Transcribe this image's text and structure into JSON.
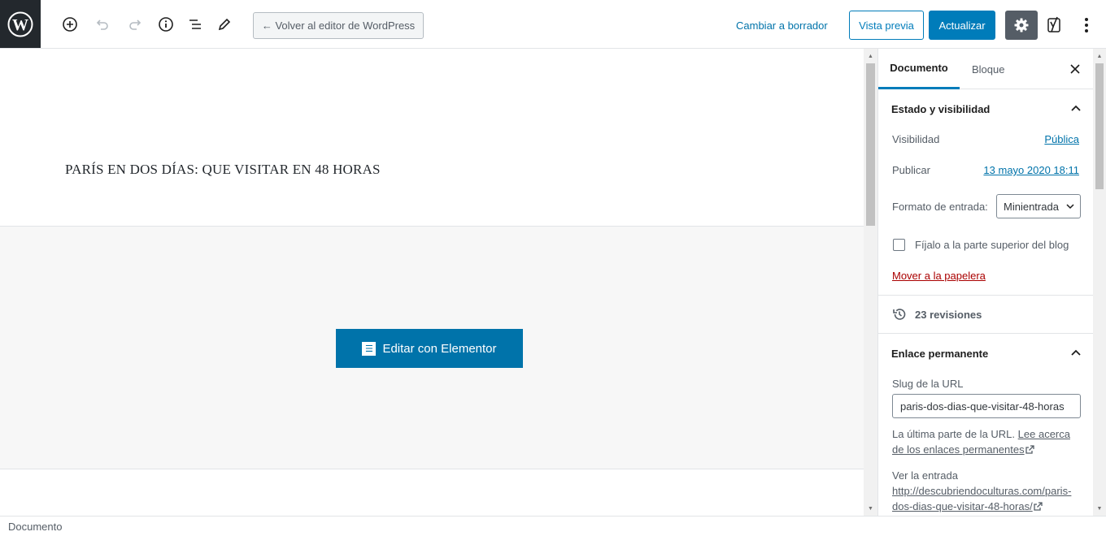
{
  "toolbar": {
    "back_label": "← Volver al editor de WordPress",
    "switch_draft": "Cambiar a borrador",
    "preview": "Vista previa",
    "update": "Actualizar"
  },
  "post": {
    "title": "PARÍS EN DOS DÍAS: QUE VISITAR EN 48 HORAS"
  },
  "elementor": {
    "button_label": "Editar con Elementor"
  },
  "sidebar": {
    "tabs": [
      {
        "label": "Documento",
        "active": true
      },
      {
        "label": "Bloque",
        "active": false
      }
    ],
    "status": {
      "heading": "Estado y visibilidad",
      "visibility_label": "Visibilidad",
      "visibility_value": "Pública",
      "publish_label": "Publicar",
      "publish_value": "13 mayo 2020 18:11",
      "format_label": "Formato de entrada:",
      "format_value": "Minientrada",
      "sticky_label": "Fíjalo a la parte superior del blog",
      "trash_label": "Mover a la papelera"
    },
    "revisions": "23 revisiones",
    "permalink": {
      "heading": "Enlace permanente",
      "slug_label": "Slug de la URL",
      "slug_value": "paris-dos-dias-que-visitar-48-horas",
      "help_text": "La última parte de la URL.",
      "help_link": "Lee acerca de los enlaces permanentes",
      "view_label": "Ver la entrada",
      "view_url_domain": "http://descubriendoculturas.com/",
      "view_url_path": "paris-dos-dias-que-visitar-48-horas/"
    }
  },
  "footer": {
    "breadcrumb": "Documento"
  },
  "colors": {
    "accent": "#007cba",
    "wp_dark": "#23282d",
    "trash": "#aa0000"
  }
}
